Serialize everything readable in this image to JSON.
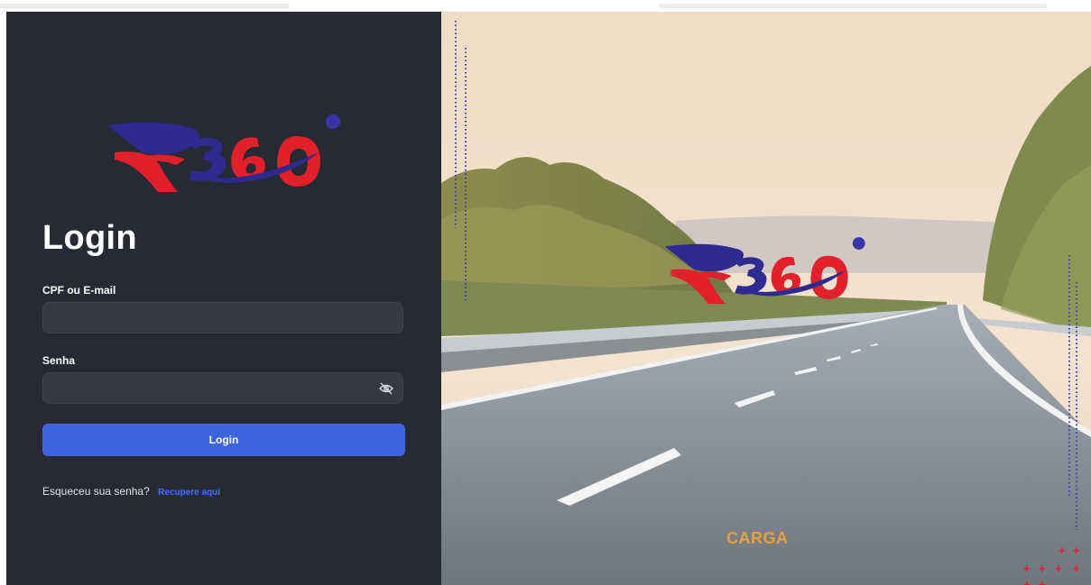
{
  "login": {
    "title": "Login",
    "email_label": "CPF ou E-mail",
    "email_value": "",
    "email_placeholder": "",
    "password_label": "Senha",
    "password_value": "",
    "password_placeholder": "",
    "submit_label": "Login",
    "forgot_text": "Esqueceu sua senha?",
    "recover_link": "Recupere aqui",
    "show_password_icon": "eye-slash-icon"
  },
  "brand": {
    "logo_name": "R360",
    "partner_name": "CARGA",
    "colors": {
      "primary_blue": "#3c63e0",
      "logo_red": "#e0202a",
      "logo_navy": "#2f2a8f",
      "panel_bg": "#272a35",
      "field_bg": "#363944",
      "partner_orange": "#e8a13a"
    }
  }
}
